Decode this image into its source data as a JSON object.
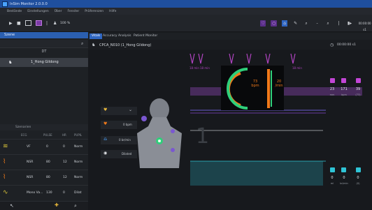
{
  "app": {
    "title": "InSim Monitor 2.0.0.0"
  },
  "menu": [
    "Bestände",
    "Einstellungen",
    "Über",
    "Fenster",
    "Präferenzen",
    "Hilfe"
  ],
  "toolbar": {
    "zoom": "100 %",
    "time": "00:00:00 s1"
  },
  "left": {
    "header": "Szene",
    "group_label": "DT",
    "patient_name": "1_Hong Gildong",
    "scenario_header": "Szenarien",
    "scenario_cols": [
      "ECG",
      "PULSE",
      "HR",
      "PUPIL"
    ],
    "scenarios": [
      {
        "name": "VF",
        "v1": "0",
        "v2": "0",
        "v3": "Norm"
      },
      {
        "name": "NSR",
        "v1": "80",
        "v2": "12",
        "v3": "Norm"
      },
      {
        "name": "NSR",
        "v1": "80",
        "v2": "12",
        "v3": "Norm"
      },
      {
        "name": "Mono Va...",
        "v1": "130",
        "v2": "0",
        "v3": "Dilat"
      }
    ]
  },
  "tabs": [
    "Vitals",
    "Accuracy Analysis",
    "Patient Monitor"
  ],
  "patient_header": "CPCA_N010 (1_Hong Gildong)",
  "monitor": {
    "settings": [
      {
        "icon": "heart-icon",
        "value": ""
      },
      {
        "icon": "heart-icon",
        "value": "0 bpm"
      },
      {
        "icon": "lungs-icon",
        "value": "0 br/min"
      },
      {
        "icon": "eye-icon",
        "value": "Dilated"
      }
    ],
    "hr_text": "73 bpm",
    "rr_text": "20 /min",
    "top_right_values": [
      {
        "value": "23",
        "unit": "mm"
      },
      {
        "value": "171",
        "unit": "bpm"
      },
      {
        "value": "39",
        "unit": "(73)"
      }
    ],
    "bottom_right_values": [
      {
        "value": "0",
        "unit": "ml"
      },
      {
        "value": "0",
        "unit": "br/min"
      },
      {
        "value": "0",
        "unit": "(0)"
      }
    ],
    "big_number": "1",
    "wave_labels": [
      "18 min",
      "18 min",
      "18 min"
    ]
  },
  "colors": {
    "accent": "#2f66c2",
    "waveform": "#b044c0",
    "orange": "#f07a1a",
    "green": "#2fcf7a",
    "cyan": "#2fc4d6"
  }
}
